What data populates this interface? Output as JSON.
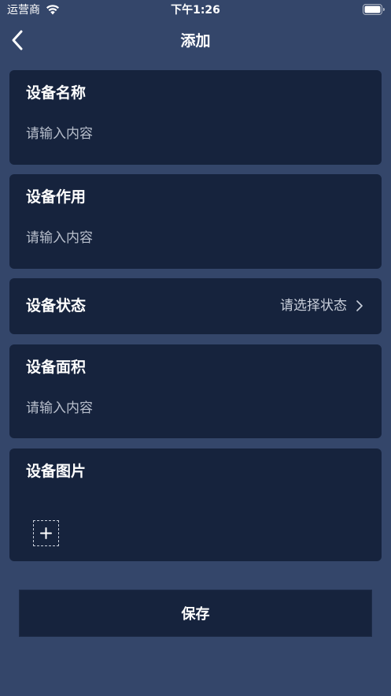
{
  "status_bar": {
    "carrier": "运营商",
    "time": "下午1:26"
  },
  "nav": {
    "title": "添加"
  },
  "form": {
    "device_name": {
      "label": "设备名称",
      "placeholder": "请输入内容"
    },
    "device_function": {
      "label": "设备作用",
      "placeholder": "请输入内容"
    },
    "device_status": {
      "label": "设备状态",
      "select_placeholder": "请选择状态"
    },
    "device_area": {
      "label": "设备面积",
      "placeholder": "请输入内容"
    },
    "device_image": {
      "label": "设备图片"
    }
  },
  "actions": {
    "save_label": "保存"
  },
  "icons": {
    "back": "chevron-left-icon",
    "select": "chevron-right-icon",
    "add": "plus-icon",
    "wifi": "wifi-icon",
    "battery": "battery-icon"
  },
  "colors": {
    "background": "#34466a",
    "card": "#16233d",
    "text": "#ffffff",
    "placeholder": "#b8bfcc"
  }
}
